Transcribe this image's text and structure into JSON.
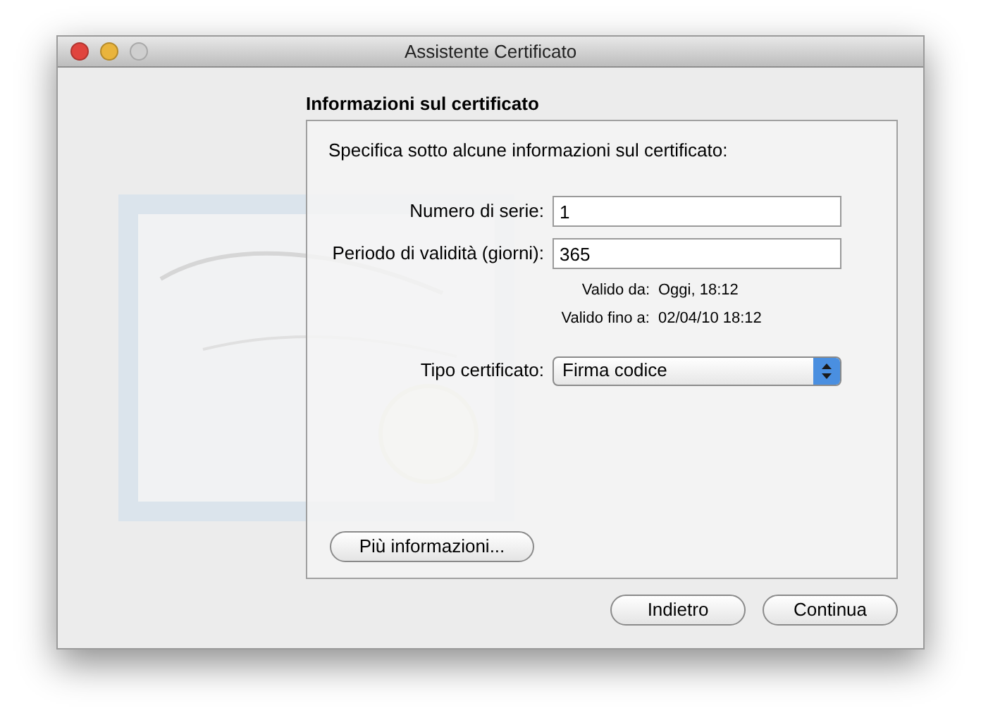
{
  "window": {
    "title": "Assistente Certificato",
    "controls": [
      {
        "kind": "close",
        "disabled": false
      },
      {
        "kind": "minimize",
        "disabled": false
      },
      {
        "kind": "zoom",
        "disabled": true
      }
    ]
  },
  "heading": "Informazioni sul certificato",
  "panel": {
    "intro": "Specifica sotto alcune informazioni sul certificato:",
    "fields": [
      {
        "label": "Numero di serie:",
        "value": "1"
      },
      {
        "label": "Periodo di validità (giorni):",
        "value": "365"
      }
    ],
    "dates": [
      {
        "label": "Valido da:",
        "value": "Oggi, 18:12"
      },
      {
        "label": "Valido fino a:",
        "value": "02/04/10 18:12"
      }
    ],
    "type": {
      "label": "Tipo certificato:",
      "value": "Firma codice"
    },
    "more_button": "Più informazioni..."
  },
  "buttons": [
    {
      "label": "Indietro",
      "default": false
    },
    {
      "label": "Continua",
      "default": false
    }
  ]
}
